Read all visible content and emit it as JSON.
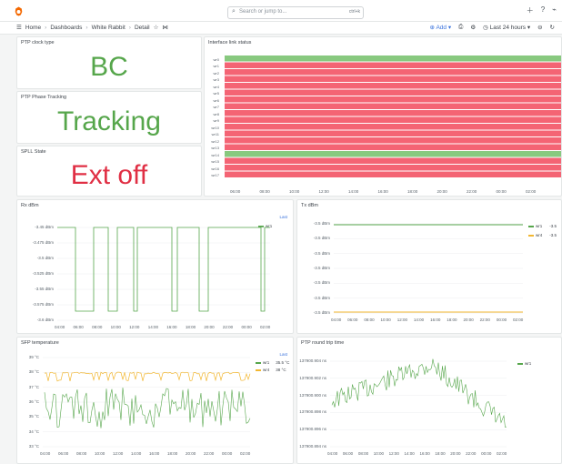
{
  "search": {
    "placeholder": "Search or jump to...",
    "shortcut": "ctrl+k"
  },
  "breadcrumb": {
    "home": "Home",
    "dashboards": "Dashboards",
    "folder": "White Rabbit",
    "current": "Detail"
  },
  "nav": {
    "add_label": "Add",
    "time_range": "Last 24 hours"
  },
  "panels": {
    "ptp_clock_type": {
      "title": "PTP clock type",
      "value": "BC"
    },
    "ptp_phase_tracking": {
      "title": "PTP Phase Tracking",
      "value": "Tracking"
    },
    "spll_state": {
      "title": "SPLL State",
      "value": "Ext off"
    },
    "interface_link_status": {
      "title": "Interface link status",
      "rows": [
        "wr0",
        "wr1",
        "wr2",
        "wr3",
        "wr4",
        "wr5",
        "wr6",
        "wr7",
        "wr8",
        "wr9",
        "wr10",
        "wr11",
        "wr12",
        "wr13",
        "wr14",
        "wr15",
        "wr16",
        "wr17"
      ],
      "states": [
        "up",
        "down",
        "down",
        "down",
        "down",
        "down",
        "down",
        "down",
        "down",
        "down",
        "down",
        "down",
        "down",
        "down",
        "up",
        "down",
        "down",
        "down"
      ],
      "xticks": [
        "06:00",
        "08:00",
        "10:00",
        "12:00",
        "14:00",
        "16:00",
        "18:00",
        "20:00",
        "22:00",
        "00:00",
        "02:00"
      ]
    },
    "rx_dbm": {
      "title": "Rx dBm",
      "yticks": [
        "-3.45 dBm",
        "-3.475 dBm",
        "-3.5 dBm",
        "-3.525 dBm",
        "-3.55 dBm",
        "-3.575 dBm",
        "-3.6 dBm"
      ],
      "xticks": [
        "04:00",
        "06:00",
        "08:00",
        "10:00",
        "12:00",
        "14:00",
        "16:00",
        "18:00",
        "20:00",
        "22:00",
        "00:00",
        "02:00"
      ],
      "legend": [
        {
          "name": "wr1",
          "color": "#56a64b"
        }
      ],
      "legend_header": "Last"
    },
    "tx_dbm": {
      "title": "Tx dBm",
      "yticks": [
        "-3.5 dBm",
        "-3.5 dBm",
        "-3.5 dBm",
        "-3.5 dBm",
        "-3.5 dBm",
        "-3.5 dBm",
        "-3.5 dBm"
      ],
      "xticks": [
        "04:00",
        "06:00",
        "08:00",
        "10:00",
        "12:00",
        "14:00",
        "16:00",
        "18:00",
        "20:00",
        "22:00",
        "00:00",
        "02:00"
      ],
      "legend": [
        {
          "name": "wr1",
          "color": "#56a64b",
          "last": "-3.5"
        },
        {
          "name": "wr4",
          "color": "#f2b731",
          "last": "-3.5"
        }
      ]
    },
    "sfp_temperature": {
      "title": "SFP temperature",
      "yticks": [
        "39 °C",
        "38 °C",
        "37 °C",
        "36 °C",
        "35 °C",
        "34 °C",
        "33 °C"
      ],
      "xticks": [
        "04:00",
        "06:00",
        "08:00",
        "10:00",
        "12:00",
        "14:00",
        "16:00",
        "18:00",
        "20:00",
        "22:00",
        "00:00",
        "02:00"
      ],
      "legend_header": "Last",
      "legend": [
        {
          "name": "wr1",
          "color": "#56a64b",
          "last": "35.5 °C"
        },
        {
          "name": "wr4",
          "color": "#f2b731",
          "last": "38 °C"
        }
      ]
    },
    "ptp_round_trip": {
      "title": "PTP round trip time",
      "yticks": [
        "137900.904 ns",
        "137900.902 ns",
        "137900.900 ns",
        "137900.898 ns",
        "137900.896 ns",
        "137900.894 ns"
      ],
      "xticks": [
        "04:00",
        "06:00",
        "08:00",
        "10:00",
        "12:00",
        "14:00",
        "16:00",
        "18:00",
        "20:00",
        "22:00",
        "00:00",
        "02:00"
      ],
      "legend": [
        {
          "name": "wr1",
          "color": "#56a64b"
        }
      ]
    }
  }
}
